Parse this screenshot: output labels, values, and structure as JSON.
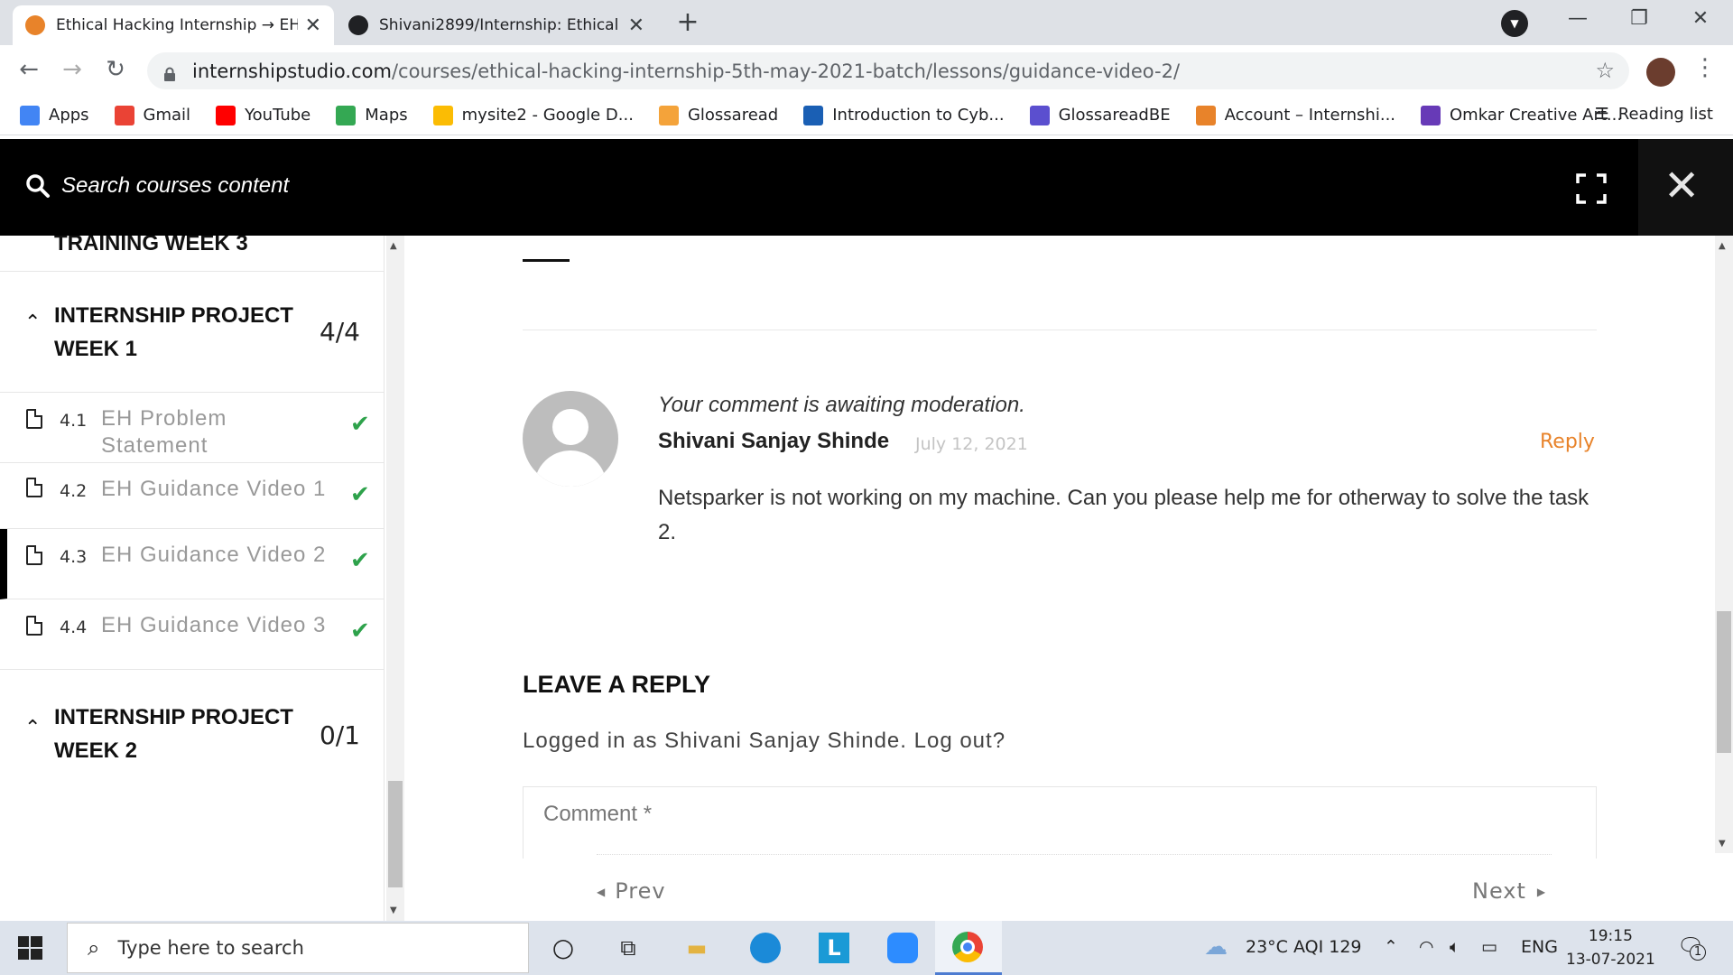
{
  "browser": {
    "tabs": [
      {
        "title": "Ethical Hacking Internship → EH G",
        "active": true
      },
      {
        "title": "Shivani2899/Internship: Ethical H",
        "active": false
      }
    ],
    "address": {
      "host": "internshipstudio.com",
      "path": "/courses/ethical-hacking-internship-5th-may-2021-batch/lessons/guidance-video-2/"
    },
    "bookmarks": [
      {
        "label": "Apps",
        "icon": "apps-grid-icon",
        "color": "#4285f4"
      },
      {
        "label": "Gmail",
        "icon": "gmail-icon",
        "color": "#ea4335"
      },
      {
        "label": "YouTube",
        "icon": "youtube-icon",
        "color": "#ff0000"
      },
      {
        "label": "Maps",
        "icon": "maps-pin-icon",
        "color": "#34a853"
      },
      {
        "label": "mysite2 - Google D...",
        "icon": "google-drive-icon",
        "color": "#fbbc04"
      },
      {
        "label": "Glossaread",
        "icon": "glossaread-icon",
        "color": "#f4a33a"
      },
      {
        "label": "Introduction to Cyb...",
        "icon": "s-logo-icon",
        "color": "#1a5fb4"
      },
      {
        "label": "GlossareadBE",
        "icon": "glossareadbe-icon",
        "color": "#5b4fcf"
      },
      {
        "label": "Account – Internshi...",
        "icon": "internshipstudio-icon",
        "color": "#e8832a"
      },
      {
        "label": "Omkar Creative Art...",
        "icon": "forms-icon",
        "color": "#673ab7"
      }
    ],
    "reading_list": "Reading list"
  },
  "course_header": {
    "search_label": "Search courses content"
  },
  "sidebar": {
    "partial_title": "TRAINING WEEK 3",
    "sections": [
      {
        "title_line1": "INTERNSHIP PROJECT",
        "title_line2": "WEEK 1",
        "count": "4/4",
        "lessons": [
          {
            "num": "4.1",
            "title": "EH Problem Statement",
            "done": true,
            "active": false
          },
          {
            "num": "4.2",
            "title": "EH Guidance Video 1",
            "done": true,
            "active": false
          },
          {
            "num": "4.3",
            "title": "EH Guidance Video 2",
            "done": true,
            "active": true
          },
          {
            "num": "4.4",
            "title": "EH Guidance Video 3",
            "done": true,
            "active": false
          }
        ]
      },
      {
        "title_line1": "INTERNSHIP PROJECT",
        "title_line2": "WEEK 2",
        "count": "0/1",
        "lessons": []
      }
    ]
  },
  "comment": {
    "moderation_note": "Your comment is awaiting moderation.",
    "author": "Shivani Sanjay Shinde",
    "date": "July 12, 2021",
    "reply_label": "Reply",
    "text": "Netsparker is not working on my machine. Can you please help me for otherway to solve the task 2."
  },
  "reply_form": {
    "heading": "LEAVE A REPLY",
    "logged_in_prefix": "Logged in as Shivani Sanjay Shinde.",
    "logout_link": "Log out?",
    "comment_placeholder": "Comment *"
  },
  "lesson_nav": {
    "prev": "Prev",
    "next": "Next"
  },
  "taskbar": {
    "search_placeholder": "Type here to search",
    "weather": "23°C  AQI 129",
    "language": "ENG",
    "time": "19:15",
    "date": "13-07-2021",
    "notification_count": "1"
  },
  "colors": {
    "accent_orange": "#e8832a",
    "check_green": "#2ea24b",
    "header_black": "#000000"
  }
}
